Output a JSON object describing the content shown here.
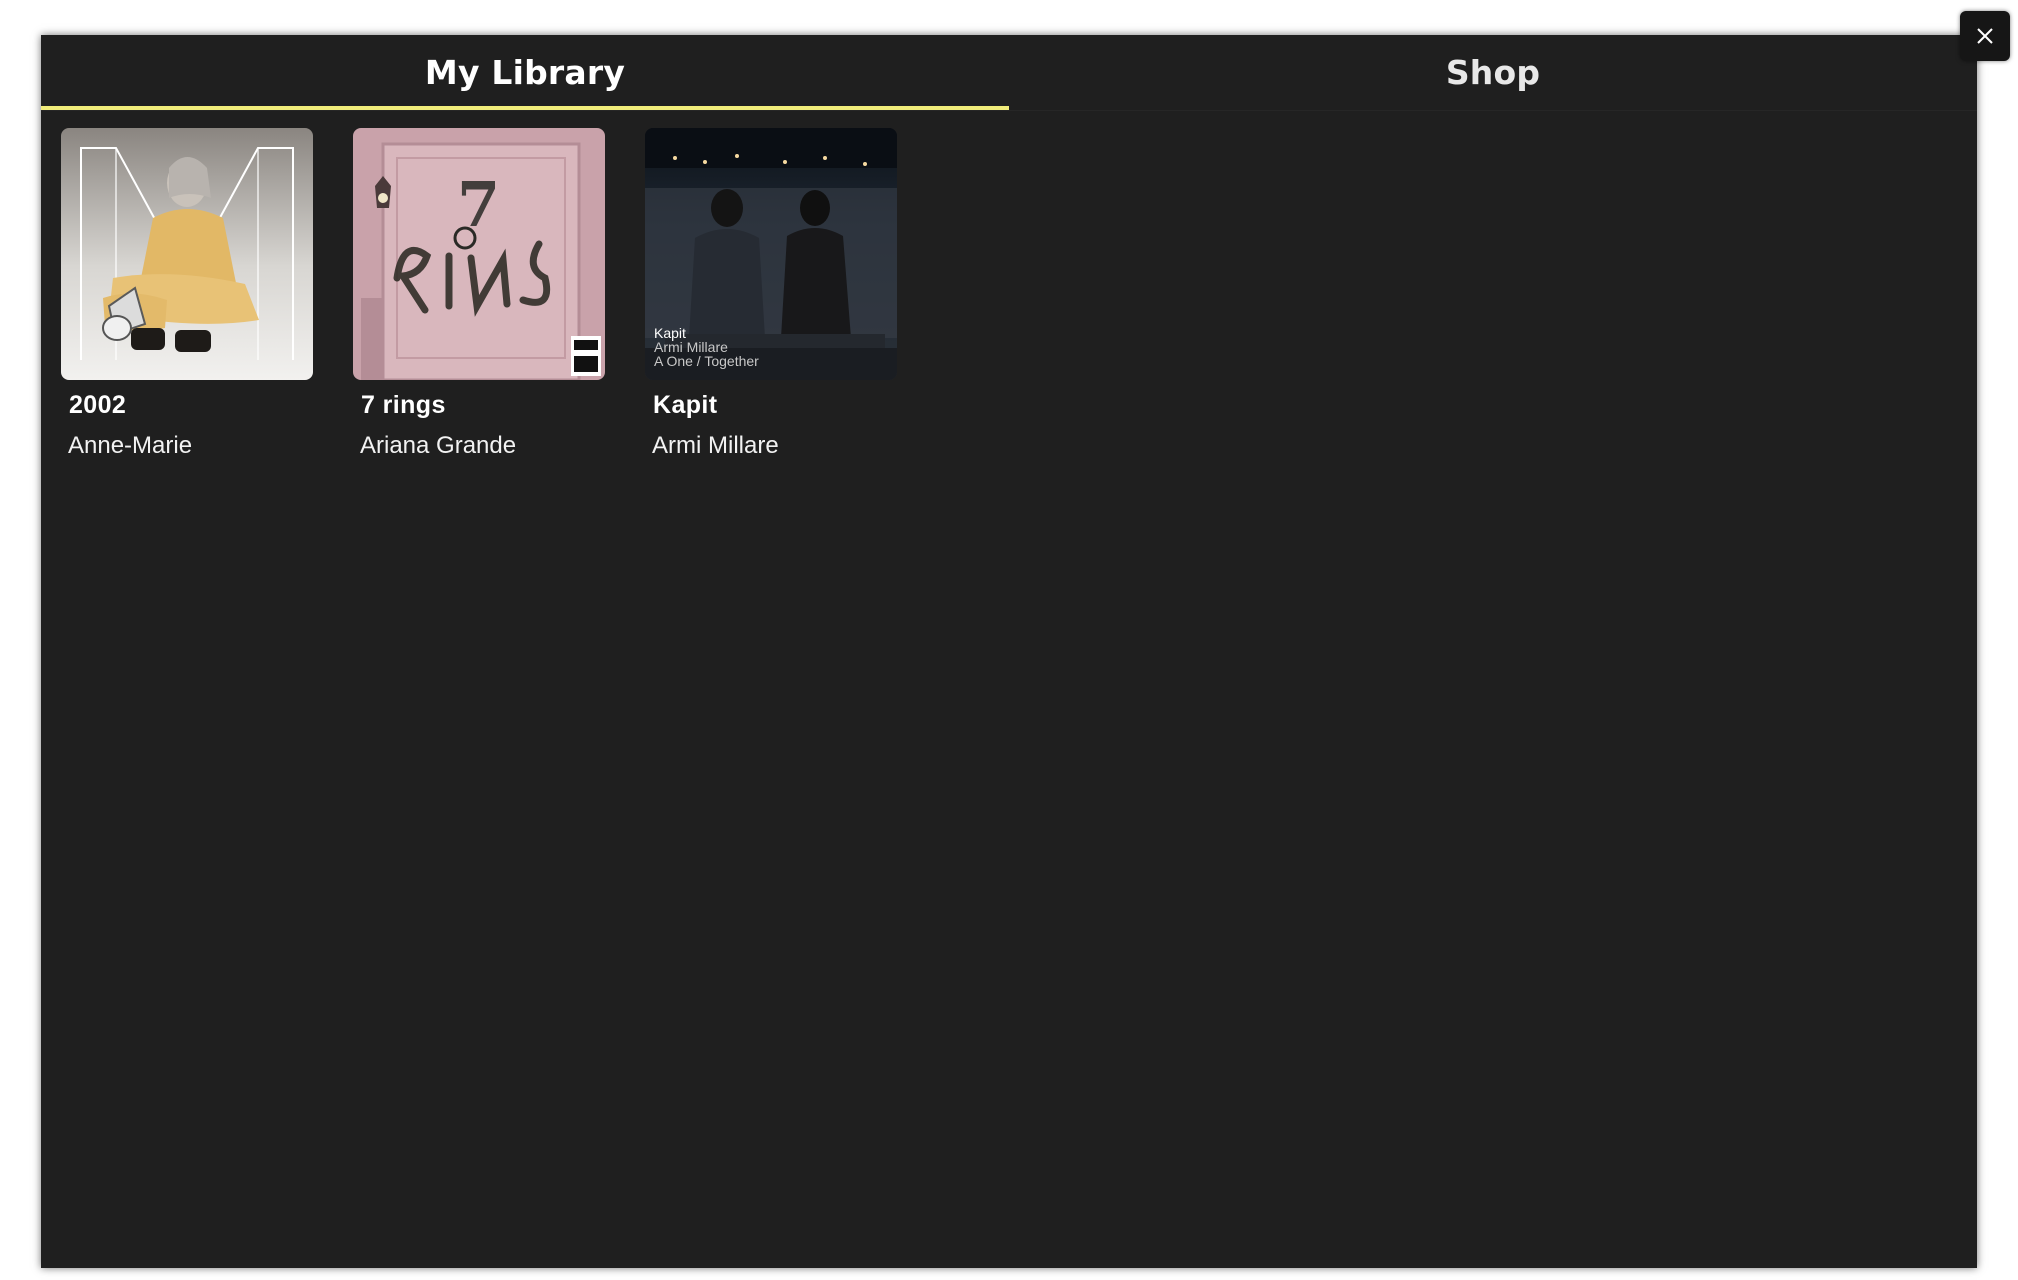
{
  "tabs": [
    {
      "label": "My Library",
      "active": true
    },
    {
      "label": "Shop",
      "active": false
    }
  ],
  "accent_color": "#f0ec7a",
  "albums": [
    {
      "title": "2002",
      "artist": "Anne-Marie",
      "cover_icon": "album-cover-2002"
    },
    {
      "title": "7 rings",
      "artist": "Ariana Grande",
      "cover_icon": "album-cover-7-rings",
      "cover_text": "7 RINGS"
    },
    {
      "title": "Kapit",
      "artist": "Armi Millare",
      "cover_icon": "album-cover-kapit",
      "cover_lines": [
        "Kapit",
        "Armi Millare",
        "A One / Together"
      ]
    }
  ],
  "close_icon": "close-icon"
}
